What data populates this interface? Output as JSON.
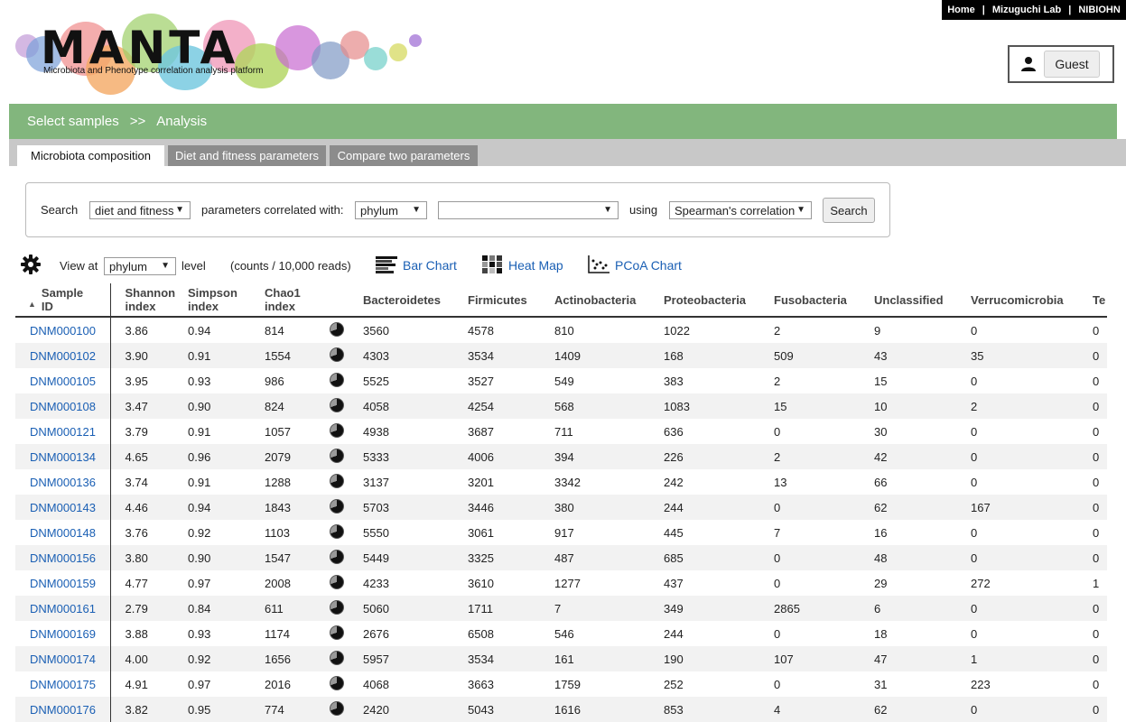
{
  "topnav": {
    "home": "Home",
    "lab": "Mizuguchi Lab",
    "org": "NIBIOHN",
    "sep": "|"
  },
  "logo": {
    "title": "MANTA",
    "tagline": "Microbiota and Phenotype correlation analysis platform"
  },
  "user": {
    "label": "Guest"
  },
  "breadcrumb": {
    "step1": "Select samples",
    "arrow": ">>",
    "step2": "Analysis"
  },
  "tabs": [
    {
      "label": "Microbiota composition",
      "active": true
    },
    {
      "label": "Diet and fitness parameters",
      "active": false
    },
    {
      "label": "Compare two parameters",
      "active": false
    }
  ],
  "search": {
    "label_search": "Search",
    "param_type": "diet and fitness",
    "label_correlated": "parameters correlated with:",
    "rank": "phylum",
    "taxon": "",
    "label_using": "using",
    "method": "Spearman's correlation",
    "button": "Search"
  },
  "view": {
    "label_view": "View at",
    "level": "phylum",
    "label_level": "level",
    "counts_note": "(counts / 10,000 reads)",
    "bar_chart": "Bar Chart",
    "heat_map": "Heat Map",
    "pcoa_chart": "PCoA Chart"
  },
  "table": {
    "headers": {
      "sample_id_1": "Sample",
      "sample_id_2": "ID",
      "shannon_1": "Shannon",
      "shannon_2": "index",
      "simpson_1": "Simpson",
      "simpson_2": "index",
      "chao1_1": "Chao1",
      "chao1_2": "index",
      "bacteroidetes": "Bacteroidetes",
      "firmicutes": "Firmicutes",
      "actinobacteria": "Actinobacteria",
      "proteobacteria": "Proteobacteria",
      "fusobacteria": "Fusobacteria",
      "unclassified": "Unclassified",
      "verrucomicrobia": "Verrucomicrobia",
      "te": "Te"
    },
    "rows": [
      {
        "id": "DNM000100",
        "shannon": "3.86",
        "simpson": "0.94",
        "chao1": "814",
        "bac": "3560",
        "fir": "4578",
        "act": "810",
        "pro": "1022",
        "fus": "2",
        "unc": "9",
        "ver": "0",
        "te": "0"
      },
      {
        "id": "DNM000102",
        "shannon": "3.90",
        "simpson": "0.91",
        "chao1": "1554",
        "bac": "4303",
        "fir": "3534",
        "act": "1409",
        "pro": "168",
        "fus": "509",
        "unc": "43",
        "ver": "35",
        "te": "0"
      },
      {
        "id": "DNM000105",
        "shannon": "3.95",
        "simpson": "0.93",
        "chao1": "986",
        "bac": "5525",
        "fir": "3527",
        "act": "549",
        "pro": "383",
        "fus": "2",
        "unc": "15",
        "ver": "0",
        "te": "0"
      },
      {
        "id": "DNM000108",
        "shannon": "3.47",
        "simpson": "0.90",
        "chao1": "824",
        "bac": "4058",
        "fir": "4254",
        "act": "568",
        "pro": "1083",
        "fus": "15",
        "unc": "10",
        "ver": "2",
        "te": "0"
      },
      {
        "id": "DNM000121",
        "shannon": "3.79",
        "simpson": "0.91",
        "chao1": "1057",
        "bac": "4938",
        "fir": "3687",
        "act": "711",
        "pro": "636",
        "fus": "0",
        "unc": "30",
        "ver": "0",
        "te": "0"
      },
      {
        "id": "DNM000134",
        "shannon": "4.65",
        "simpson": "0.96",
        "chao1": "2079",
        "bac": "5333",
        "fir": "4006",
        "act": "394",
        "pro": "226",
        "fus": "2",
        "unc": "42",
        "ver": "0",
        "te": "0"
      },
      {
        "id": "DNM000136",
        "shannon": "3.74",
        "simpson": "0.91",
        "chao1": "1288",
        "bac": "3137",
        "fir": "3201",
        "act": "3342",
        "pro": "242",
        "fus": "13",
        "unc": "66",
        "ver": "0",
        "te": "0"
      },
      {
        "id": "DNM000143",
        "shannon": "4.46",
        "simpson": "0.94",
        "chao1": "1843",
        "bac": "5703",
        "fir": "3446",
        "act": "380",
        "pro": "244",
        "fus": "0",
        "unc": "62",
        "ver": "167",
        "te": "0"
      },
      {
        "id": "DNM000148",
        "shannon": "3.76",
        "simpson": "0.92",
        "chao1": "1103",
        "bac": "5550",
        "fir": "3061",
        "act": "917",
        "pro": "445",
        "fus": "7",
        "unc": "16",
        "ver": "0",
        "te": "0"
      },
      {
        "id": "DNM000156",
        "shannon": "3.80",
        "simpson": "0.90",
        "chao1": "1547",
        "bac": "5449",
        "fir": "3325",
        "act": "487",
        "pro": "685",
        "fus": "0",
        "unc": "48",
        "ver": "0",
        "te": "0"
      },
      {
        "id": "DNM000159",
        "shannon": "4.77",
        "simpson": "0.97",
        "chao1": "2008",
        "bac": "4233",
        "fir": "3610",
        "act": "1277",
        "pro": "437",
        "fus": "0",
        "unc": "29",
        "ver": "272",
        "te": "1"
      },
      {
        "id": "DNM000161",
        "shannon": "2.79",
        "simpson": "0.84",
        "chao1": "611",
        "bac": "5060",
        "fir": "1711",
        "act": "7",
        "pro": "349",
        "fus": "2865",
        "unc": "6",
        "ver": "0",
        "te": "0"
      },
      {
        "id": "DNM000169",
        "shannon": "3.88",
        "simpson": "0.93",
        "chao1": "1174",
        "bac": "2676",
        "fir": "6508",
        "act": "546",
        "pro": "244",
        "fus": "0",
        "unc": "18",
        "ver": "0",
        "te": "0"
      },
      {
        "id": "DNM000174",
        "shannon": "4.00",
        "simpson": "0.92",
        "chao1": "1656",
        "bac": "5957",
        "fir": "3534",
        "act": "161",
        "pro": "190",
        "fus": "107",
        "unc": "47",
        "ver": "1",
        "te": "0"
      },
      {
        "id": "DNM000175",
        "shannon": "4.91",
        "simpson": "0.97",
        "chao1": "2016",
        "bac": "4068",
        "fir": "3663",
        "act": "1759",
        "pro": "252",
        "fus": "0",
        "unc": "31",
        "ver": "223",
        "te": "0"
      },
      {
        "id": "DNM000176",
        "shannon": "3.82",
        "simpson": "0.95",
        "chao1": "774",
        "bac": "2420",
        "fir": "5043",
        "act": "1616",
        "pro": "853",
        "fus": "4",
        "unc": "62",
        "ver": "0",
        "te": "0"
      }
    ]
  },
  "colors": {
    "accent_green": "#82b67d",
    "link_blue": "#1a5fb4",
    "tab_inactive": "#8c8c8c"
  }
}
